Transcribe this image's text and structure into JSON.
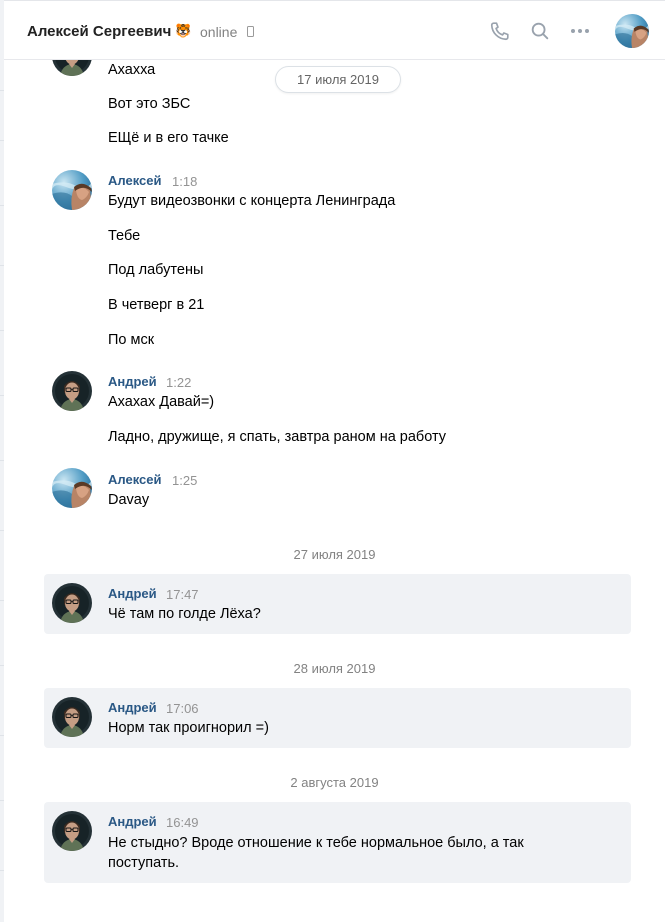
{
  "header": {
    "name": "Алексей Сергеевич",
    "emoji": "🐯",
    "status": "online"
  },
  "dates": {
    "pill": "17 июля 2019",
    "d1": "27 июля 2019",
    "d2": "28 июля 2019",
    "d3": "2 августа 2019"
  },
  "messages": {
    "g0": [
      "Ахахха",
      "Вот это ЗБС",
      "ЕЩё и в его тачке"
    ],
    "g1": {
      "author": "Алексей",
      "time": "1:18",
      "lines": [
        "Будут видеозвонки с концерта Ленинграда",
        "Тебе",
        "Под лабутены",
        "В четверг в 21",
        "По мск"
      ]
    },
    "g2": {
      "author": "Андрей",
      "time": "1:22",
      "lines": [
        "Ахахах Давай=)",
        "Ладно, дружище, я спать, завтра раном на работу"
      ]
    },
    "g3": {
      "author": "Алексей",
      "time": "1:25",
      "lines": [
        "Davay"
      ]
    },
    "g4": {
      "author": "Андрей",
      "time": "17:47",
      "lines": [
        "Чё там по голде Лёха?"
      ]
    },
    "g5": {
      "author": "Андрей",
      "time": "17:06",
      "lines": [
        "Норм так проигнорил =)"
      ]
    },
    "g6": {
      "author": "Андрей",
      "time": "16:49",
      "lines": [
        "Не стыдно? Вроде отношение к тебе нормальное было, а так поступать."
      ]
    }
  },
  "icons": {
    "call": "phone-icon",
    "search": "search-icon",
    "more": "more-icon",
    "mobile": "mobile-icon"
  },
  "colors": {
    "author": "#2a5885",
    "highlight": "#f0f2f5",
    "icon": "#99a2ad"
  }
}
